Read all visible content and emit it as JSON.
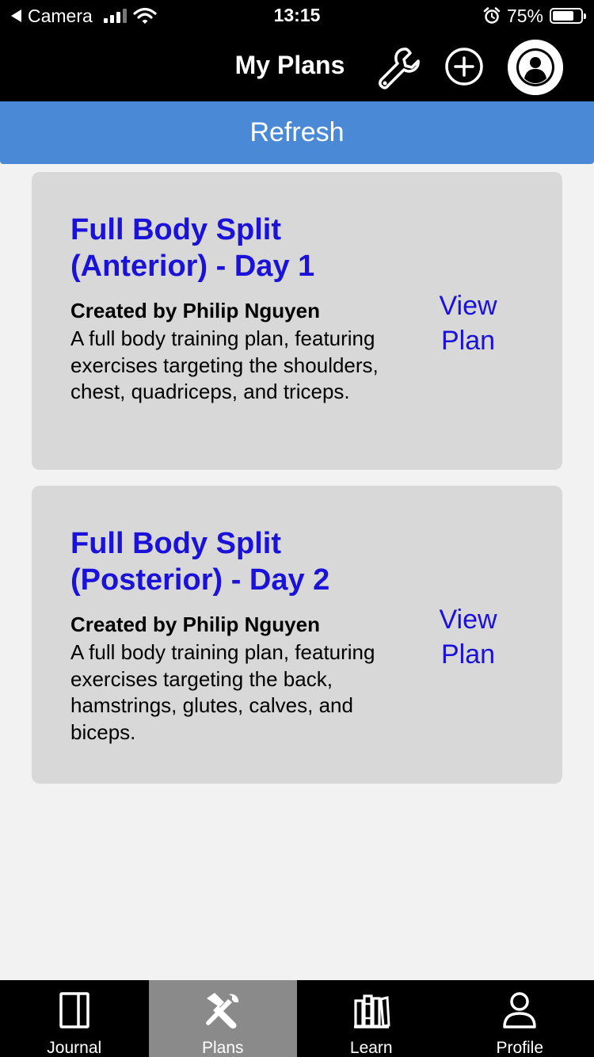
{
  "status_bar": {
    "back_app": "Camera",
    "time": "13:15",
    "battery_text": "75%",
    "battery_level": 0.75
  },
  "header": {
    "title": "My Plans",
    "icons": [
      "wrench-icon",
      "add-circle-icon",
      "profile-avatar-icon"
    ]
  },
  "refresh": {
    "label": "Refresh",
    "color": "#4a89d6"
  },
  "plans": [
    {
      "title_line1": "Full Body Split",
      "title_line2": "(Anterior) - Day 1",
      "author": "Created by Philip Nguyen",
      "description": "A full body training plan, featuring exercises targeting the shoulders, chest, quadriceps, and triceps.",
      "view_line1": "View",
      "view_line2": "Plan"
    },
    {
      "title_line1": "Full Body Split",
      "title_line2": "(Posterior) - Day 2",
      "author": "Created by Philip Nguyen",
      "description": "A full body training plan, featuring exercises targeting the back, hamstrings, glutes, calves, and biceps.",
      "view_line1": "View",
      "view_line2": "Plan"
    }
  ],
  "tabs": [
    {
      "label": "Journal",
      "icon": "journal-icon",
      "active": false
    },
    {
      "label": "Plans",
      "icon": "plans-tools-icon",
      "active": true
    },
    {
      "label": "Learn",
      "icon": "learn-books-icon",
      "active": false
    },
    {
      "label": "Profile",
      "icon": "profile-icon",
      "active": false
    }
  ],
  "colors": {
    "link_blue": "#1a12d8",
    "card_bg": "#d8d8d8",
    "active_tab_bg": "#8a8a8a"
  }
}
